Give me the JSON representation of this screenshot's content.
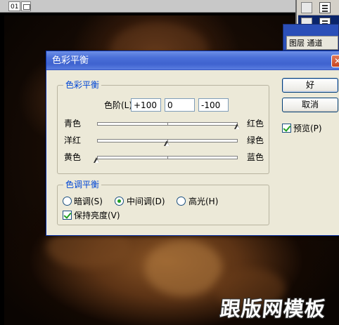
{
  "document": {
    "index": "01"
  },
  "dialog": {
    "title": "色彩平衡",
    "close_glyph": "✕",
    "color_balance": {
      "legend": "色彩平衡",
      "levels_label": "色阶(L):",
      "levels_values": [
        "+100",
        "0",
        "-100"
      ],
      "sliders": [
        {
          "left": "青色",
          "right": "红色",
          "value": 100
        },
        {
          "left": "洋红",
          "right": "绿色",
          "value": 0
        },
        {
          "left": "黄色",
          "right": "蓝色",
          "value": -100
        }
      ]
    },
    "tone_balance": {
      "legend": "色调平衡",
      "options": [
        {
          "label": "暗调(S)",
          "checked": false
        },
        {
          "label": "中间调(D)",
          "checked": true
        },
        {
          "label": "高光(H)",
          "checked": false
        }
      ],
      "preserve_luminosity": {
        "label": "保持亮度(V)",
        "checked": true
      }
    },
    "buttons": {
      "ok": "好",
      "cancel": "取消"
    },
    "preview": {
      "label": "预览(P)",
      "checked": true
    }
  },
  "layers_panel": {
    "tab_partial": "图层 通道"
  },
  "watermark": "跟版网模板",
  "colors": {
    "titlebar": "#4a6fd8",
    "dialog_bg": "#ece9d8",
    "legend_text": "#0046d5",
    "canvas_glow": "#8a5526"
  }
}
